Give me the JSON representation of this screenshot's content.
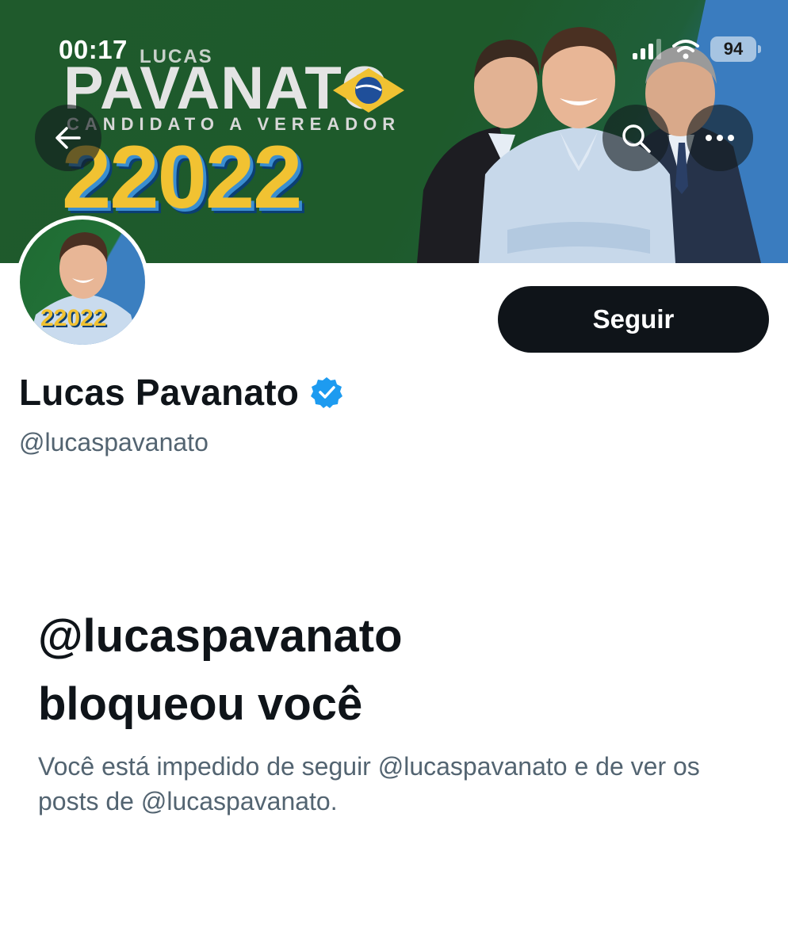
{
  "status_bar": {
    "time": "00:17",
    "battery": "94",
    "icons": [
      "signal-icon",
      "wifi-icon",
      "battery-charging-icon"
    ]
  },
  "banner": {
    "campaign_name": "PAVANATO",
    "campaign_small_text": "LUCAS",
    "campaign_role": "CANDIDATO A VEREADOR",
    "campaign_number": "22022"
  },
  "nav": {
    "icons": [
      "back-arrow-icon",
      "search-icon",
      "more-dots-icon"
    ]
  },
  "avatar": {
    "number": "22022"
  },
  "profile": {
    "display_name": "Lucas Pavanato",
    "handle": "@lucaspavanato",
    "verified": true,
    "follow_label": "Seguir"
  },
  "blocked": {
    "title_line1": "@lucaspavanato",
    "title_line2": "bloqueou você",
    "message": "Você está impedido de seguir @lucaspavanato e de ver os posts de @lucaspavanato."
  },
  "colors": {
    "banner_green": "#1f5a2c",
    "banner_blue": "#3a7cbf",
    "number_yellow": "#f1c232",
    "button_dark": "#0f1419",
    "secondary_text": "#536471",
    "verified_blue": "#1d9bf0"
  }
}
